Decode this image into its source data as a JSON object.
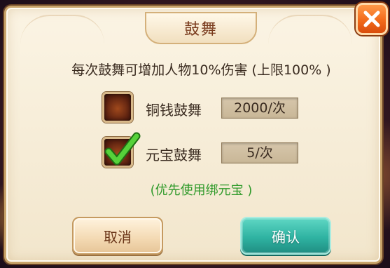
{
  "dialog": {
    "title": "鼓舞",
    "description": "每次鼓舞可增加人物10%伤害 (上限100% )",
    "options": [
      {
        "label": "铜钱鼓舞",
        "price": "2000/次",
        "checked": false
      },
      {
        "label": "元宝鼓舞",
        "price": "5/次",
        "checked": true
      }
    ],
    "hint": "(优先使用绑元宝 )",
    "cancel_label": "取消",
    "confirm_label": "确认"
  },
  "icons": {
    "close": "close-icon",
    "check": "checkmark-icon"
  },
  "colors": {
    "hint_green": "#2f9a2a",
    "confirm_teal": "#2fb3a2",
    "close_orange": "#f26a1a",
    "title_brown": "#7a3c1e"
  }
}
